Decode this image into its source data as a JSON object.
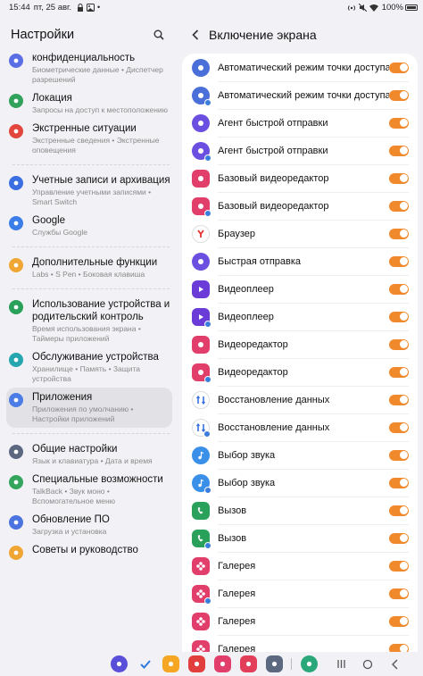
{
  "status": {
    "time": "15:44",
    "date": "пт, 25 авг.",
    "battery": "100%"
  },
  "left": {
    "title": "Настройки",
    "items": [
      {
        "title": "конфиденциальность",
        "sub": "Биометрические данные • Диспетчер разрешений",
        "color": "#5a6fe6",
        "icon": "shield-icon"
      },
      {
        "title": "Локация",
        "sub": "Запросы на доступ к местоположению",
        "color": "#31a25b",
        "icon": "location-pin-icon"
      },
      {
        "title": "Экстренные ситуации",
        "sub": "Экстренные сведения • Экстренные оповещения",
        "color": "#e2463c",
        "icon": "alert-icon"
      },
      {
        "title": "Учетные записи и архивация",
        "sub": "Управление учетными записями • Smart Switch",
        "color": "#3a6fe1",
        "icon": "sync-icon"
      },
      {
        "title": "Google",
        "sub": "Службы Google",
        "color": "#3c7ee8",
        "icon": "google-icon"
      },
      {
        "title": "Дополнительные функции",
        "sub": "Labs • S Pen • Боковая клавиша",
        "color": "#f0a632",
        "icon": "star-gear-icon"
      },
      {
        "title": "Использование устройства и родительский контроль",
        "sub": "Время использования экрана • Таймеры приложений",
        "color": "#2aa15a",
        "icon": "wellbeing-icon"
      },
      {
        "title": "Обслуживание устройства",
        "sub": "Хранилище • Память • Защита устройства",
        "color": "#26a7b0",
        "icon": "care-icon"
      },
      {
        "title": "Приложения",
        "sub": "Приложения по умолчанию • Настройки приложений",
        "color": "#4c7ce6",
        "icon": "apps-grid-icon"
      },
      {
        "title": "Общие настройки",
        "sub": "Язык и клавиатура • Дата и время",
        "color": "#5b6880",
        "icon": "sliders-icon"
      },
      {
        "title": "Специальные возможности",
        "sub": "TalkBack • Звук моно • Вспомогательное меню",
        "color": "#34a55c",
        "icon": "accessibility-icon"
      },
      {
        "title": "Обновление ПО",
        "sub": "Загрузка и установка",
        "color": "#4b74e0",
        "icon": "update-icon"
      },
      {
        "title": "Советы и руководство",
        "sub": "",
        "color": "#f0a632",
        "icon": "tips-icon"
      }
    ]
  },
  "right": {
    "title": "Включение экрана",
    "apps": [
      {
        "label": "Автоматический режим точки доступа",
        "color": "#4a6fd8",
        "icon": "hotspot-icon",
        "badge": false,
        "sq": false
      },
      {
        "label": "Автоматический режим точки доступа",
        "color": "#4a6fd8",
        "icon": "hotspot-icon",
        "badge": true,
        "sq": false
      },
      {
        "label": "Агент быстрой отправки",
        "color": "#6b4fe0",
        "icon": "quick-share-icon",
        "badge": false,
        "sq": false
      },
      {
        "label": "Агент быстрой отправки",
        "color": "#6b4fe0",
        "icon": "quick-share-icon",
        "badge": true,
        "sq": false
      },
      {
        "label": "Базовый видеоредактор",
        "color": "#e23e6b",
        "icon": "video-editor-icon",
        "badge": false,
        "sq": true
      },
      {
        "label": "Базовый видеоредактор",
        "color": "#e23e6b",
        "icon": "video-editor-icon",
        "badge": true,
        "sq": true
      },
      {
        "label": "Браузер",
        "color": "#ffffff",
        "icon": "yandex-browser-icon",
        "badge": false,
        "sq": false
      },
      {
        "label": "Быстрая отправка",
        "color": "#6b4fe0",
        "icon": "quick-share-icon",
        "badge": false,
        "sq": false
      },
      {
        "label": "Видеоплеер",
        "color": "#6a3bd6",
        "icon": "play-icon",
        "badge": false,
        "sq": true
      },
      {
        "label": "Видеоплеер",
        "color": "#6a3bd6",
        "icon": "play-icon",
        "badge": true,
        "sq": true
      },
      {
        "label": "Видеоредактор",
        "color": "#e23e6b",
        "icon": "video-editor-icon",
        "badge": false,
        "sq": true
      },
      {
        "label": "Видеоредактор",
        "color": "#e23e6b",
        "icon": "video-editor-icon",
        "badge": true,
        "sq": true
      },
      {
        "label": "Восстановление данных",
        "color": "#ffffff",
        "icon": "data-restore-icon",
        "badge": false,
        "sq": false
      },
      {
        "label": "Восстановление данных",
        "color": "#ffffff",
        "icon": "data-restore-icon",
        "badge": true,
        "sq": false
      },
      {
        "label": "Выбор звука",
        "color": "#3a8fe8",
        "icon": "music-note-icon",
        "badge": false,
        "sq": false
      },
      {
        "label": "Выбор звука",
        "color": "#3a8fe8",
        "icon": "music-note-icon",
        "badge": true,
        "sq": false
      },
      {
        "label": "Вызов",
        "color": "#2aa15a",
        "icon": "phone-icon",
        "badge": false,
        "sq": true
      },
      {
        "label": "Вызов",
        "color": "#2aa15a",
        "icon": "phone-icon",
        "badge": true,
        "sq": true
      },
      {
        "label": "Галерея",
        "color": "#e23e6b",
        "icon": "gallery-flower-icon",
        "badge": false,
        "sq": true
      },
      {
        "label": "Галерея",
        "color": "#e23e6b",
        "icon": "gallery-flower-icon",
        "badge": true,
        "sq": true
      },
      {
        "label": "Галерея",
        "color": "#e23e6b",
        "icon": "gallery-flower-icon",
        "badge": false,
        "sq": true
      },
      {
        "label": "Галерея",
        "color": "#e23e6b",
        "icon": "gallery-flower-icon",
        "badge": true,
        "sq": true
      }
    ]
  },
  "colors": {
    "toggle_on": "#f0892b",
    "background": "#f2f1f5",
    "card": "#ffffff"
  },
  "dock": [
    {
      "name": "bixby-app-icon",
      "color": "#5a4fd9"
    },
    {
      "name": "checkmark-app-icon",
      "color": "#f2f1f5"
    },
    {
      "name": "notes-app-icon",
      "color": "#f5a623"
    },
    {
      "name": "sticky-app-icon",
      "color": "#e23e3e"
    },
    {
      "name": "flower-app-icon",
      "color": "#e23e6b"
    },
    {
      "name": "camera-app-icon",
      "color": "#e23e5a"
    },
    {
      "name": "apps-grid-app-icon",
      "color": "#5b6880"
    },
    {
      "name": "recent-app-icon",
      "color": "#2aa87a"
    }
  ]
}
